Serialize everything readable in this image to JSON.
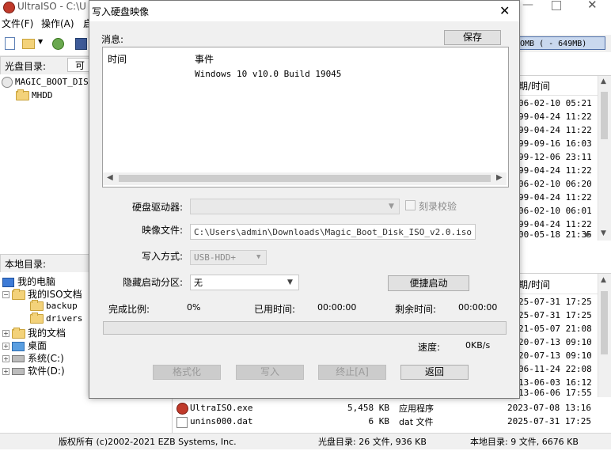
{
  "app": {
    "title": "UltraISO - C:\\U",
    "menu": [
      "文件(F)",
      "操作(A)",
      "启"
    ],
    "cd_dir_label": "光盘目录:",
    "cd_dir_value": "可引",
    "size_text": "OMB ( - 649MB)",
    "cd_tree": {
      "root": "MAGIC_BOOT_DISK",
      "child": "MHDD"
    },
    "right_top": {
      "header": "期/时间",
      "dates": [
        "06-02-10 05:21",
        "99-04-24 11:22",
        "99-04-24 11:22",
        "99-09-16 16:03",
        "99-12-06 23:11",
        "99-04-24 11:22",
        "06-02-10 06:20",
        "99-04-24 11:22",
        "06-02-10 06:01",
        "99-04-24 11:22",
        "00-05-18 21:35"
      ]
    },
    "local_dir_label": "本地目录:",
    "local_tree": [
      {
        "label": "我的电脑",
        "kind": "computer"
      },
      {
        "label": "我的ISO文档",
        "kind": "folder"
      },
      {
        "label": "backup",
        "kind": "folder"
      },
      {
        "label": "drivers",
        "kind": "folder"
      },
      {
        "label": "我的文档",
        "kind": "folder"
      },
      {
        "label": "桌面",
        "kind": "desktop"
      },
      {
        "label": "系统(C:)",
        "kind": "drive"
      },
      {
        "label": "软件(D:)",
        "kind": "drive"
      }
    ],
    "right_bottom": {
      "header": "期/时间",
      "dates": [
        "25-07-31 17:25",
        "25-07-31 17:25",
        "21-05-07 21:08",
        "20-07-13 09:10",
        "20-07-13 09:10",
        "06-11-24 22:08",
        "13-06-03 16:12",
        "13-06-06 17:55"
      ]
    },
    "files": [
      {
        "name": "UltraISO.exe",
        "size": "5,458 KB",
        "type": "应用程序",
        "date": "2023-07-08 13:16"
      },
      {
        "name": "unins000.dat",
        "size": "6 KB",
        "type": "dat 文件",
        "date": "2025-07-31 17:25"
      }
    ],
    "status": {
      "copyright": "版权所有 (c)2002-2021 EZB Systems, Inc.",
      "cd_info": "光盘目录: 26 文件, 936 KB",
      "local_info": "本地目录: 9 文件, 6676 KB"
    }
  },
  "dialog": {
    "title": "写入硬盘映像",
    "close_glyph": "✕",
    "messages_label": "消息:",
    "save_button": "保存",
    "log": {
      "col_time": "时间",
      "col_event": "事件",
      "rows": [
        {
          "time": "",
          "event": "Windows 10 v10.0 Build 19045"
        }
      ]
    },
    "disk_drive_label": "硬盘驱动器:",
    "disk_drive_value": "",
    "verify_label": "刻录校验",
    "image_file_label": "映像文件:",
    "image_file_value": "C:\\Users\\admin\\Downloads\\Magic_Boot_Disk_ISO_v2.0.iso",
    "write_method_label": "写入方式:",
    "write_method_value": "USB-HDD+",
    "hidden_partition_label": "隐藏启动分区:",
    "hidden_partition_value": "无",
    "quick_boot_button": "便捷启动",
    "progress_label": "完成比例:",
    "progress_value": "0%",
    "progress_fraction": 0,
    "elapsed_label": "已用时间:",
    "elapsed_value": "00:00:00",
    "remaining_label": "剩余时间:",
    "remaining_value": "00:00:00",
    "speed_label": "速度:",
    "speed_value": "0KB/s",
    "buttons": {
      "format": "格式化",
      "write": "写入",
      "abort": "终止[A]",
      "back": "返回"
    }
  }
}
